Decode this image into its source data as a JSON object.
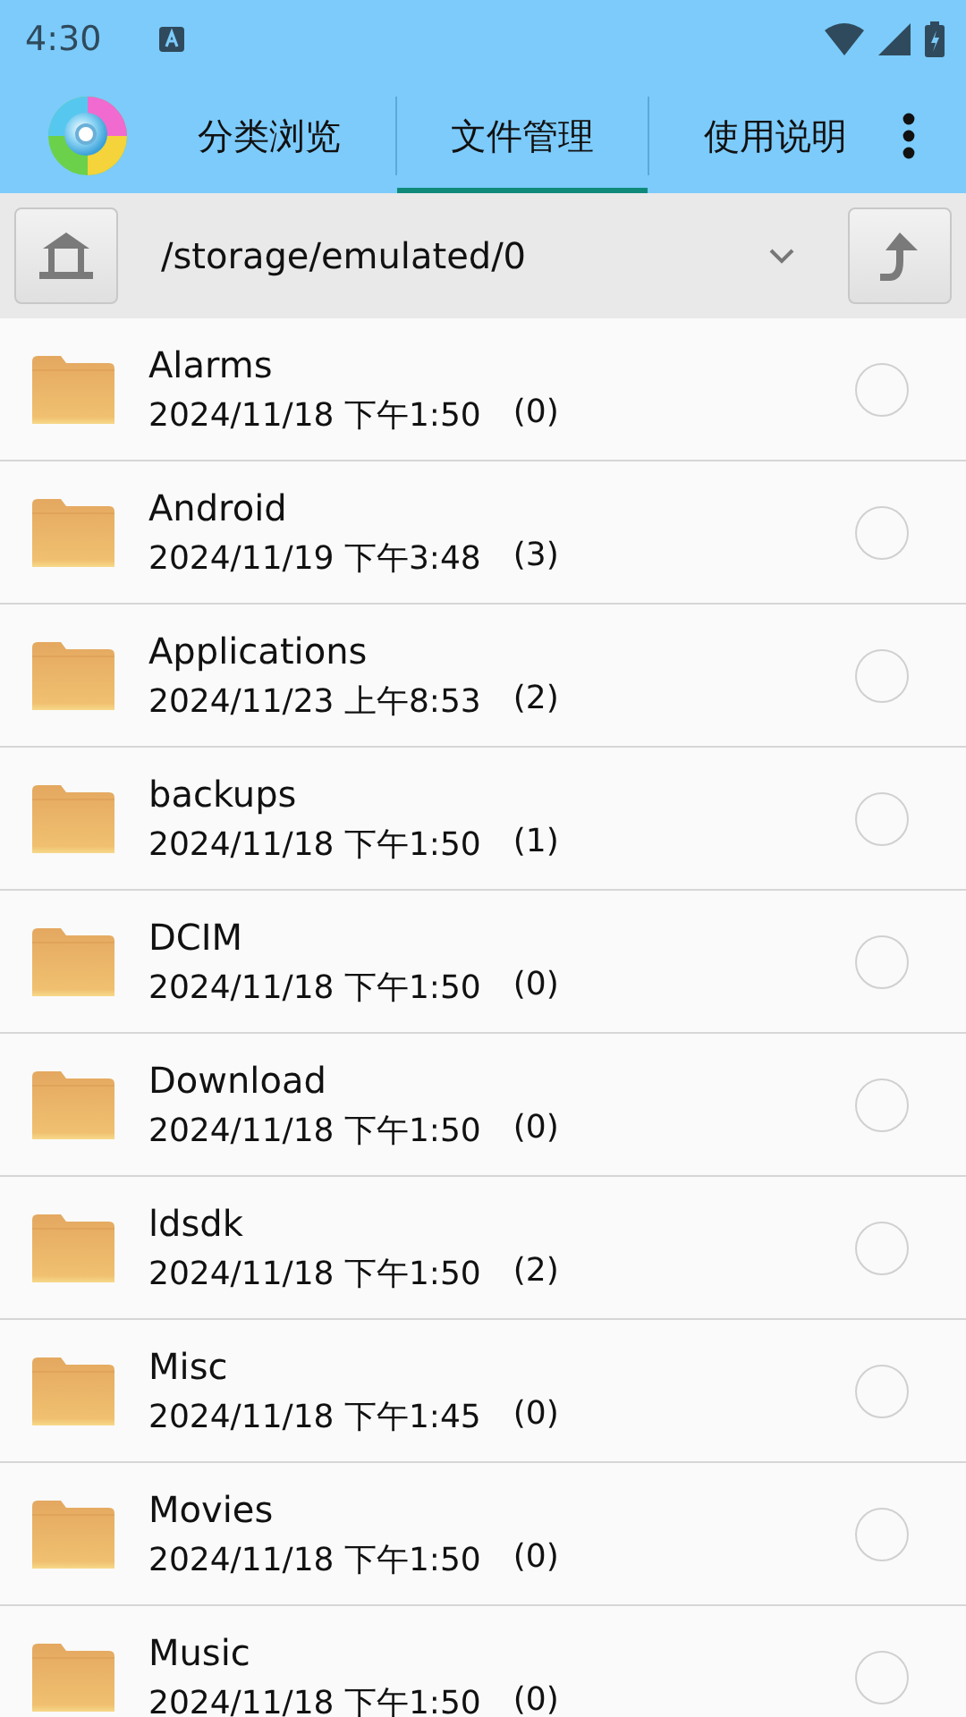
{
  "status_bar": {
    "time": "4:30"
  },
  "tabs": [
    {
      "label": "分类浏览",
      "selected": false
    },
    {
      "label": "文件管理",
      "selected": true
    },
    {
      "label": "使用说明",
      "selected": false
    }
  ],
  "path_bar": {
    "path": "/storage/emulated/0"
  },
  "files": [
    {
      "name": "Alarms",
      "date": "2024/11/18 下午1:50",
      "count": "(0)",
      "checked": false
    },
    {
      "name": "Android",
      "date": "2024/11/19 下午3:48",
      "count": "(3)",
      "checked": false
    },
    {
      "name": "Applications",
      "date": "2024/11/23 上午8:53",
      "count": "(2)",
      "checked": false
    },
    {
      "name": "backups",
      "date": "2024/11/18 下午1:50",
      "count": "(1)",
      "checked": false
    },
    {
      "name": "DCIM",
      "date": "2024/11/18 下午1:50",
      "count": "(0)",
      "checked": false
    },
    {
      "name": "Download",
      "date": "2024/11/18 下午1:50",
      "count": "(0)",
      "checked": false
    },
    {
      "name": "ldsdk",
      "date": "2024/11/18 下午1:50",
      "count": "(2)",
      "checked": false
    },
    {
      "name": "Misc",
      "date": "2024/11/18 下午1:45",
      "count": "(0)",
      "checked": false
    },
    {
      "name": "Movies",
      "date": "2024/11/18 下午1:50",
      "count": "(0)",
      "checked": false
    },
    {
      "name": "Music",
      "date": "2024/11/18 下午1:50",
      "count": "(0)",
      "checked": false
    }
  ]
}
